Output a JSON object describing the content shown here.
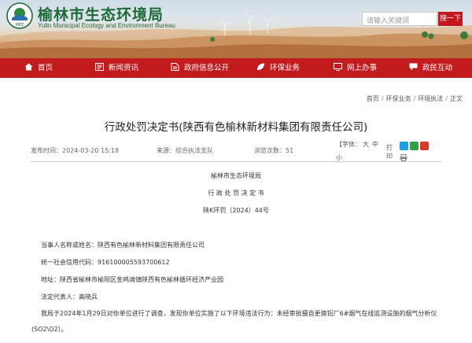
{
  "header": {
    "site_title": "榆林市生态环境局",
    "site_subtitle": "Yulin Municipal Ecology and Environment Bureau",
    "logo_text": "MEE",
    "search_placeholder": "请输入关键词",
    "search_button": "搜一下"
  },
  "nav": {
    "items": [
      {
        "label": "首页",
        "icon": "home-icon"
      },
      {
        "label": "新闻资讯",
        "icon": "news-icon"
      },
      {
        "label": "政府信息公开",
        "icon": "document-icon"
      },
      {
        "label": "环保业务",
        "icon": "leaf-icon"
      },
      {
        "label": "网上办事",
        "icon": "monitor-icon"
      },
      {
        "label": "政民互动",
        "icon": "chat-icon"
      }
    ]
  },
  "breadcrumb": [
    "首页",
    "环保业务",
    "环境执法",
    "正文"
  ],
  "breadcrumb_separator": "/",
  "article": {
    "title": "行政处罚决定书(陕西有色榆林新材料集团有限责任公司)",
    "publish_time": "发布时间：2024-03-20 15:18",
    "source": "来源：综合执法支队",
    "views": "浏览次数：51",
    "font_size": {
      "label": "【字体：",
      "large": "大",
      "medium": "中",
      "small_a": "小",
      "small_b": "小】"
    },
    "print_label": "打印",
    "issuer": "榆林市生态环境局",
    "doc_type": "行 政 处 罚 决 定 书",
    "doc_number": "陕K环罚〔2024〕44号",
    "party": "当事人名称或姓名：陕西有色榆林新材料集团有限责任公司",
    "credit_code": "统一社会信用代码：916100005593700612",
    "address": "地址：陕西省榆林市榆阳区金鸡滩镇陕西有色榆林循环经济产业园",
    "representative": "法定代表人：高晓兵",
    "body_line1": "我局于2024年1月29日对你单位进行了调查，发现你单位实施了以下环境违法行为：未经审批擅自更换铝厂6#烟气在线监测设施的烟气分析仪",
    "body_line2": "(SO2\\O2）。"
  },
  "colors": {
    "nav_red": "#c31a1d",
    "title_green": "#1d6a38",
    "search_red": "#c4161c"
  }
}
